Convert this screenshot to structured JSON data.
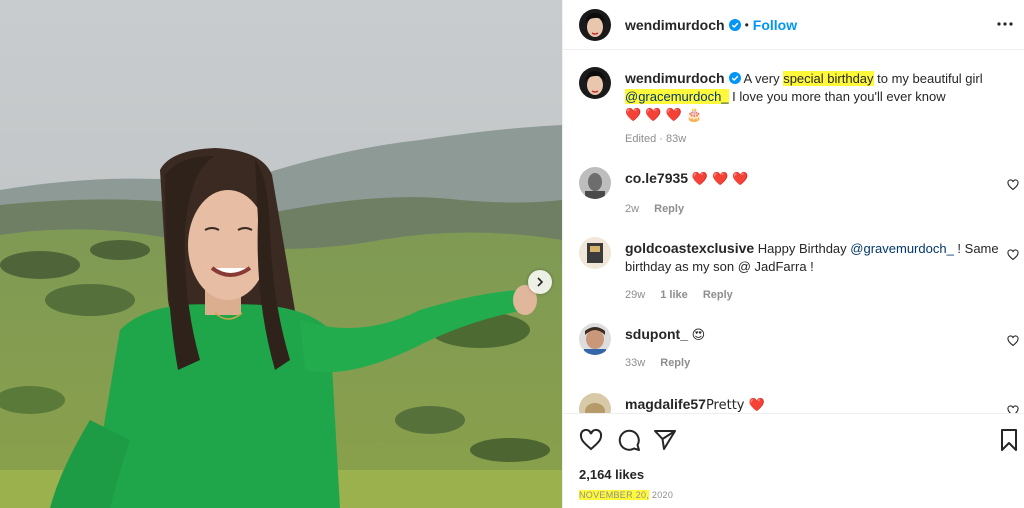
{
  "post": {
    "author": "wendimurdoch",
    "follow_label": "Follow",
    "separator": "•"
  },
  "caption": {
    "author": "wendimurdoch",
    "text_a": " A very ",
    "text_highlight_1": "special birthday",
    "text_b": " to my beautiful girl ",
    "mention": "@gracemurdoch_",
    "text_c": " I love you more than you'll ever know ",
    "emoji_end": "❤️ ❤️ ❤️ 🎂",
    "meta": "Edited · 83w"
  },
  "comments": [
    {
      "user": "co.le7935",
      "text": "❤️ ❤️ ❤️",
      "time": "2w",
      "likes": "",
      "reply": "Reply"
    },
    {
      "user": "goldcoastexclusive",
      "text_a": " Happy Birthday ",
      "mention": "@gravemurdoch_",
      "text_b": " ! Same birthday as my son @ JadFarra !",
      "time": "29w",
      "likes": "1 like",
      "reply": "Reply"
    },
    {
      "user": "sdupont_",
      "text": "😍",
      "time": "33w",
      "likes": "",
      "reply": "Reply"
    },
    {
      "user": "magdalife57",
      "text": " Pretty ❤️"
    }
  ],
  "footer": {
    "likes": "2,164 likes",
    "date_highlight": "NOVEMBER 20,",
    "date_rest": " 2020"
  },
  "icons": [
    "verified-icon",
    "more-icon",
    "heart-icon",
    "comment-icon",
    "share-icon",
    "bookmark-icon",
    "carousel-next-icon"
  ],
  "colors": {
    "accent": "#0095f6",
    "highlight": "#fff93a",
    "heart": "#e0245e",
    "sweater": "#1fa64a"
  }
}
